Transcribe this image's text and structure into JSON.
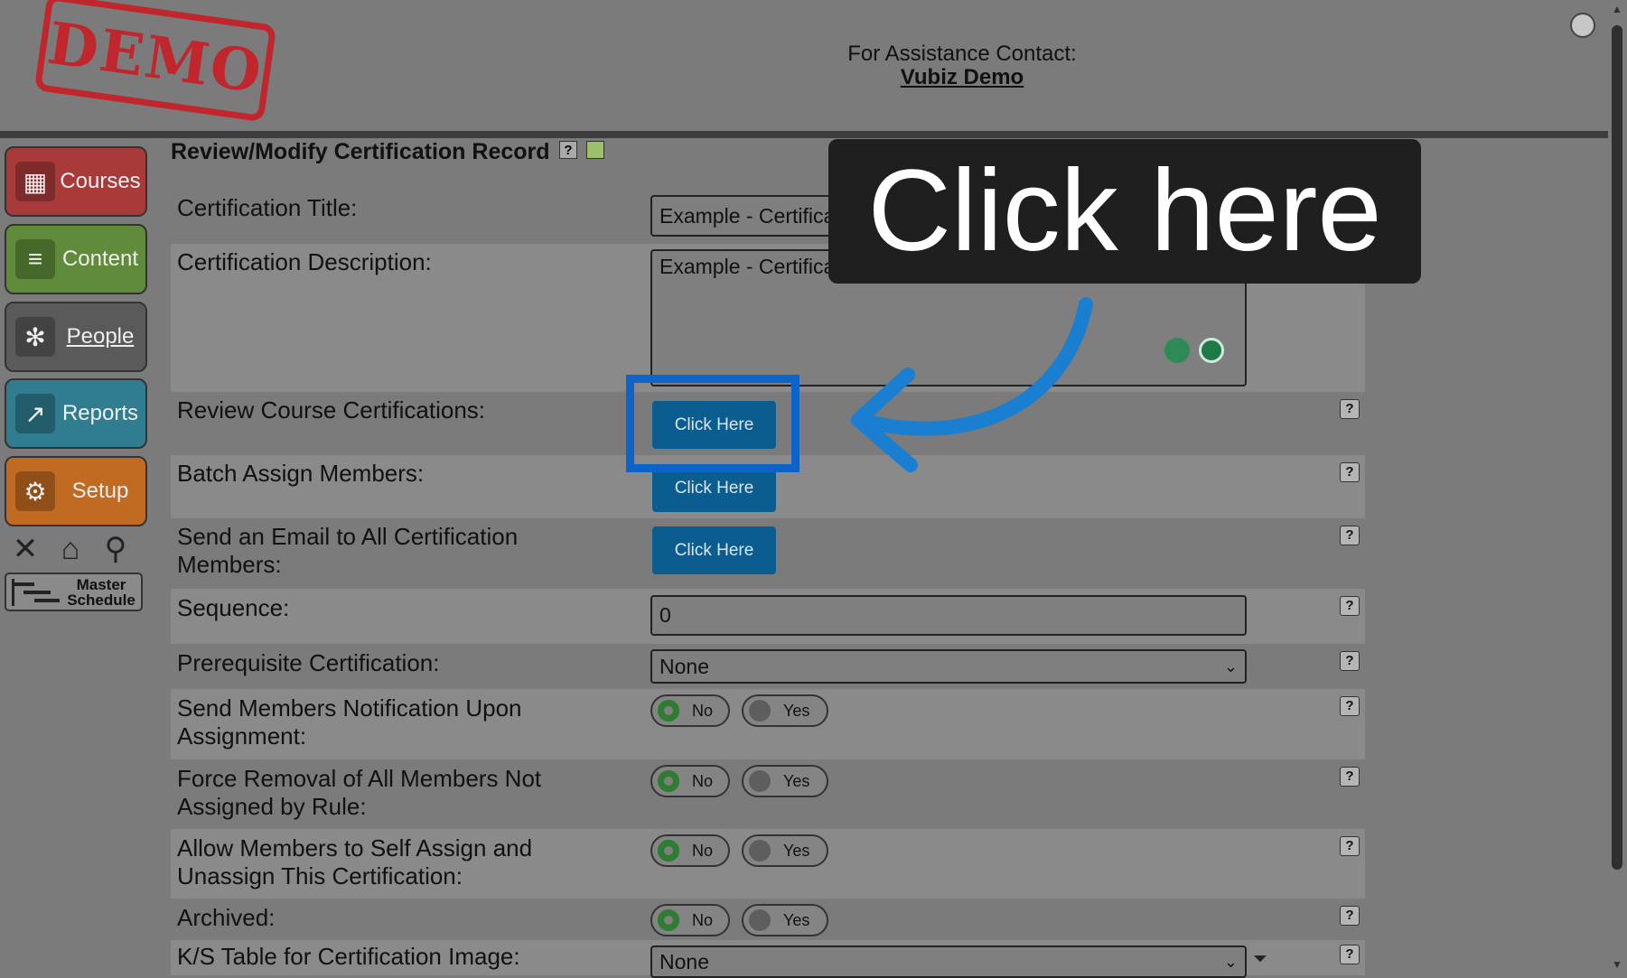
{
  "header": {
    "stamp": "DEMO",
    "assist_label": "For Assistance Contact:",
    "assist_link": "Vubiz Demo"
  },
  "sidebar": {
    "items": [
      {
        "label": "Courses",
        "color": "#a83a3a",
        "icon": "presenter-icon"
      },
      {
        "label": "Content",
        "color": "#5f8b3a",
        "icon": "stack-icon"
      },
      {
        "label": "People",
        "color": "#5a5a5a",
        "icon": "people-network-icon"
      },
      {
        "label": "Reports",
        "color": "#2f7d8f",
        "icon": "trend-chart-icon"
      },
      {
        "label": "Setup",
        "color": "#c06a22",
        "icon": "gears-icon"
      }
    ],
    "master_schedule": "Master Schedule"
  },
  "form": {
    "title": "Review/Modify Certification Record",
    "certification_title": {
      "label": "Certification Title:",
      "value": "Example - Certification"
    },
    "certification_description": {
      "label": "Certification Description:",
      "value": "Example - Certification"
    },
    "review_course_certifications": {
      "label": "Review Course Certifications:",
      "button": "Click Here"
    },
    "batch_assign_members": {
      "label": "Batch Assign Members:",
      "button": "Click Here"
    },
    "send_email": {
      "label": "Send an Email to All Certification Members:",
      "button": "Click Here"
    },
    "sequence": {
      "label": "Sequence:",
      "value": "0"
    },
    "prerequisite": {
      "label": "Prerequisite Certification:",
      "value": "None"
    },
    "notify": {
      "label": "Send Members Notification Upon Assignment:",
      "no": "No",
      "yes": "Yes",
      "selected": "No"
    },
    "force_removal": {
      "label": "Force Removal of All Members Not Assigned by Rule:",
      "no": "No",
      "yes": "Yes",
      "selected": "No"
    },
    "self_assign": {
      "label": "Allow Members to Self Assign and Unassign This Certification:",
      "no": "No",
      "yes": "Yes",
      "selected": "No"
    },
    "archived": {
      "label": "Archived:",
      "no": "No",
      "yes": "Yes",
      "selected": "No"
    },
    "ks_table": {
      "label": "K/S Table for Certification Image:",
      "value": "None"
    },
    "help_glyph": "?"
  },
  "overlay": {
    "callout": "Click here",
    "highlight_color": "#0e63c9",
    "arrow_color": "#1a7fd1"
  }
}
